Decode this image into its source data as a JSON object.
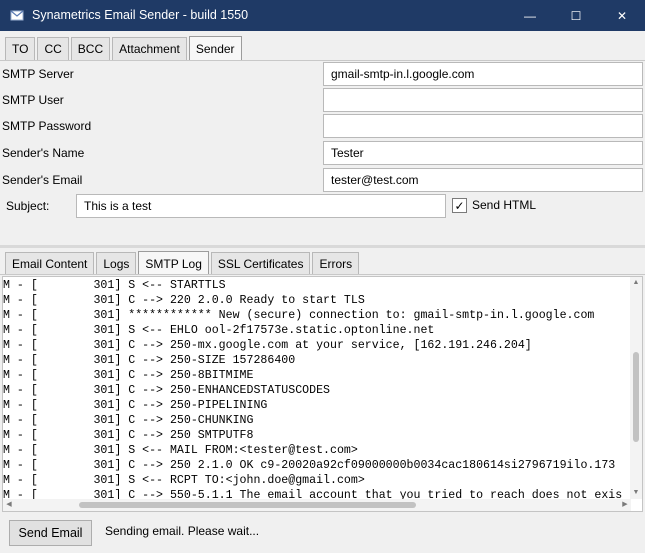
{
  "window": {
    "title": "Synametrics Email Sender - build 1550",
    "controls": {
      "minimize": "—",
      "maximize": "☐",
      "close": "✕"
    },
    "title_bar_color": "#1f3a66"
  },
  "top_tabs": [
    {
      "label": "TO",
      "active": false
    },
    {
      "label": "CC",
      "active": false
    },
    {
      "label": "BCC",
      "active": false
    },
    {
      "label": "Attachment",
      "active": false
    },
    {
      "label": "Sender",
      "active": true
    }
  ],
  "sender": {
    "smtp_server": {
      "label": "SMTP Server",
      "value": "gmail-smtp-in.l.google.com"
    },
    "smtp_user": {
      "label": "SMTP User",
      "value": ""
    },
    "smtp_password": {
      "label": "SMTP Password",
      "value": ""
    },
    "senders_name": {
      "label": "Sender's Name",
      "value": "Tester"
    },
    "senders_email": {
      "label": "Sender's Email",
      "value": "tester@test.com"
    }
  },
  "subject": {
    "label": "Subject:",
    "value": "This is a test"
  },
  "send_html": {
    "label": "Send HTML",
    "checked": true,
    "check_glyph": "✓"
  },
  "bottom_tabs": [
    {
      "label": "Email Content",
      "active": false
    },
    {
      "label": "Logs",
      "active": false
    },
    {
      "label": "SMTP Log",
      "active": true
    },
    {
      "label": "SSL Certificates",
      "active": false
    },
    {
      "label": "Errors",
      "active": false
    }
  ],
  "smtp_log": [
    "M - [        301] S <-- STARTTLS",
    "M - [        301] C --> 220 2.0.0 Ready to start TLS",
    "M - [        301] ************ New (secure) connection to: gmail-smtp-in.l.google.com",
    "M - [        301] S <-- EHLO ool-2f17573e.static.optonline.net",
    "M - [        301] C --> 250-mx.google.com at your service, [162.191.246.204]",
    "M - [        301] C --> 250-SIZE 157286400",
    "M - [        301] C --> 250-8BITMIME",
    "M - [        301] C --> 250-ENHANCEDSTATUSCODES",
    "M - [        301] C --> 250-PIPELINING",
    "M - [        301] C --> 250-CHUNKING",
    "M - [        301] C --> 250 SMTPUTF8",
    "M - [        301] S <-- MAIL FROM:<tester@test.com>",
    "M - [        301] C --> 250 2.1.0 OK c9-20020a92cf09000000b0034cac180614si2796719ilo.173",
    "M - [        301] S <-- RCPT TO:<john.doe@gmail.com>",
    "M - [        301] C --> 550-5.1.1 The email account that you tried to reach does not exis"
  ],
  "scrollbars": {
    "up": "▲",
    "down": "▼",
    "left": "◀",
    "right": "▶"
  },
  "footer": {
    "send_button": "Send Email",
    "status": "Sending email. Please wait..."
  }
}
